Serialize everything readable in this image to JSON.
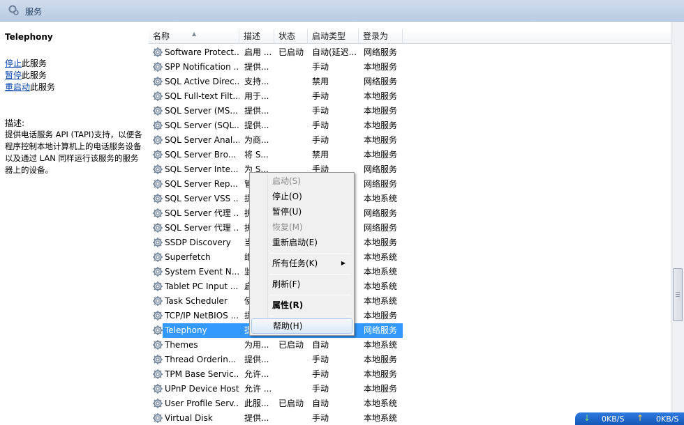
{
  "window": {
    "title": "服务"
  },
  "left_panel": {
    "service_name": "Telephony",
    "actions": [
      {
        "link": "停止",
        "suffix": "此服务"
      },
      {
        "link": "暂停",
        "suffix": "此服务"
      },
      {
        "link": "重启动",
        "suffix": "此服务"
      }
    ],
    "description_label": "描述:",
    "description_text": "提供电话服务 API (TAPI)支持，以便各程序控制本地计算机上的电话服务设备以及通过 LAN 同样运行该服务的服务器上的设备。"
  },
  "columns": [
    "名称",
    "描述",
    "状态",
    "启动类型",
    "登录为"
  ],
  "rows": [
    {
      "name": "Software Protect...",
      "desc": "启用 ...",
      "status": "已启动",
      "startup": "自动(延迟...",
      "logon": "网络服务"
    },
    {
      "name": "SPP Notification ...",
      "desc": "提供...",
      "status": "",
      "startup": "手动",
      "logon": "本地服务"
    },
    {
      "name": "SQL Active Direc...",
      "desc": "支持...",
      "status": "",
      "startup": "禁用",
      "logon": "网络服务"
    },
    {
      "name": "SQL Full-text Filt...",
      "desc": "用于...",
      "status": "",
      "startup": "手动",
      "logon": "本地服务"
    },
    {
      "name": "SQL Server (MS...",
      "desc": "提供...",
      "status": "",
      "startup": "手动",
      "logon": "本地服务"
    },
    {
      "name": "SQL Server (SQL...",
      "desc": "提供...",
      "status": "",
      "startup": "手动",
      "logon": "本地服务"
    },
    {
      "name": "SQL Server Anal...",
      "desc": "为商...",
      "status": "",
      "startup": "手动",
      "logon": "本地服务"
    },
    {
      "name": "SQL Server Bro...",
      "desc": "将 S...",
      "status": "",
      "startup": "禁用",
      "logon": "本地服务"
    },
    {
      "name": "SQL Server Inte...",
      "desc": "为 S...",
      "status": "",
      "startup": "手动",
      "logon": "网络服务"
    },
    {
      "name": "SQL Server Rep...",
      "desc": "管...",
      "status": "",
      "startup": "",
      "logon": "网络服务"
    },
    {
      "name": "SQL Server VSS ...",
      "desc": "提...",
      "status": "",
      "startup": "",
      "logon": "本地系统"
    },
    {
      "name": "SQL Server 代理 ...",
      "desc": "执...",
      "status": "",
      "startup": "",
      "logon": "网络服务"
    },
    {
      "name": "SQL Server 代理 ...",
      "desc": "执...",
      "status": "",
      "startup": "",
      "logon": "网络服务"
    },
    {
      "name": "SSDP Discovery",
      "desc": "当...",
      "status": "",
      "startup": "",
      "logon": "本地服务"
    },
    {
      "name": "Superfetch",
      "desc": "维...",
      "status": "",
      "startup": "",
      "logon": "本地系统"
    },
    {
      "name": "System Event N...",
      "desc": "监...",
      "status": "",
      "startup": "",
      "logon": "本地系统"
    },
    {
      "name": "Tablet PC Input ...",
      "desc": "启...",
      "status": "",
      "startup": "",
      "logon": "本地系统"
    },
    {
      "name": "Task Scheduler",
      "desc": "使...",
      "status": "",
      "startup": "",
      "logon": "本地系统"
    },
    {
      "name": "TCP/IP NetBIOS ...",
      "desc": "提...",
      "status": "",
      "startup": "",
      "logon": "本地服务"
    },
    {
      "name": "Telephony",
      "desc": "提...",
      "status": "",
      "startup": "",
      "logon": "网络服务",
      "selected": true
    },
    {
      "name": "Themes",
      "desc": "为用...",
      "status": "已启动",
      "startup": "自动",
      "logon": "本地系统"
    },
    {
      "name": "Thread Orderin...",
      "desc": "提供...",
      "status": "",
      "startup": "手动",
      "logon": "本地服务"
    },
    {
      "name": "TPM Base Servic...",
      "desc": "允许...",
      "status": "",
      "startup": "手动",
      "logon": "本地服务"
    },
    {
      "name": "UPnP Device Host",
      "desc": "允许 ...",
      "status": "",
      "startup": "手动",
      "logon": "本地服务"
    },
    {
      "name": "User Profile Serv...",
      "desc": "此服...",
      "status": "已启动",
      "startup": "自动",
      "logon": "本地系统"
    },
    {
      "name": "Virtual Disk",
      "desc": "提供...",
      "status": "",
      "startup": "手动",
      "logon": "本地系统"
    }
  ],
  "context_menu": {
    "items": [
      {
        "label": "启动(S)",
        "state": "disabled"
      },
      {
        "label": "停止(O)",
        "state": "enabled"
      },
      {
        "label": "暂停(U)",
        "state": "enabled"
      },
      {
        "label": "恢复(M)",
        "state": "disabled"
      },
      {
        "label": "重新启动(E)",
        "state": "enabled"
      },
      {
        "label": "所有任务(K)",
        "state": "submenu"
      },
      {
        "label": "刷新(F)",
        "state": "enabled"
      },
      {
        "label": "属性(R)",
        "state": "bold"
      },
      {
        "label": "帮助(H)",
        "state": "hover"
      }
    ]
  },
  "network": {
    "down": "0KB/S",
    "up": "0KB/S"
  },
  "colors": {
    "selection": "#3399ff",
    "link": "#0645ad"
  }
}
